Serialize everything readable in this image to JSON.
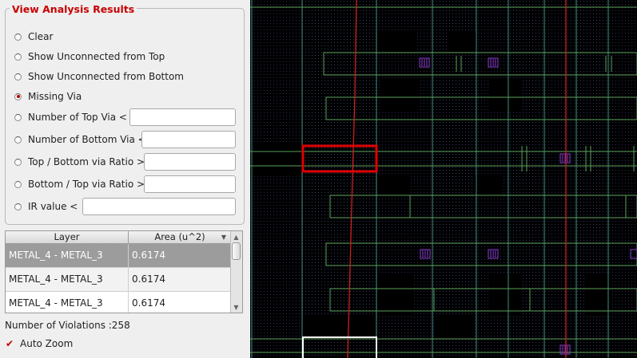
{
  "panel": {
    "title": "View Analysis Results",
    "options": [
      {
        "label": "Clear",
        "selected": false
      },
      {
        "label": "Show Unconnected from Top",
        "selected": false
      },
      {
        "label": "Show Unconnected from Bottom",
        "selected": false
      },
      {
        "label": "Missing Via",
        "selected": true
      },
      {
        "label": "Number of Top Via <",
        "selected": false,
        "value": ""
      },
      {
        "label": "Number of Bottom Via <",
        "selected": false,
        "value": ""
      },
      {
        "label": "Top / Bottom via Ratio >",
        "selected": false,
        "value": ""
      },
      {
        "label": "Bottom / Top via Ratio >",
        "selected": false,
        "value": ""
      },
      {
        "label": "IR value <",
        "selected": false,
        "value": ""
      }
    ]
  },
  "table": {
    "columns": [
      "Layer",
      "Area (u^2)"
    ],
    "rows": [
      {
        "layer": "METAL_4 - METAL_3",
        "area": "0.6174",
        "selected": true
      },
      {
        "layer": "METAL_4 - METAL_3",
        "area": "0.6174",
        "selected": false
      },
      {
        "layer": "METAL_4 - METAL_3",
        "area": "0.6174",
        "selected": false
      }
    ],
    "sort_icon": "sort-down-icon"
  },
  "violations": "Number of Violations :258",
  "auto_zoom": {
    "label": "Auto Zoom",
    "checked": true
  },
  "colors": {
    "accent": "#c80000",
    "canvas_bg": "#000000",
    "wire_green": "#5aa05a",
    "wire_teal": "#3f8f86",
    "wire_red": "#d21e1e",
    "via_purple": "#8c3cd2",
    "grid_dots": "#2a2f56",
    "highlight": "#e00000",
    "zoom_box": "#ffffff"
  }
}
